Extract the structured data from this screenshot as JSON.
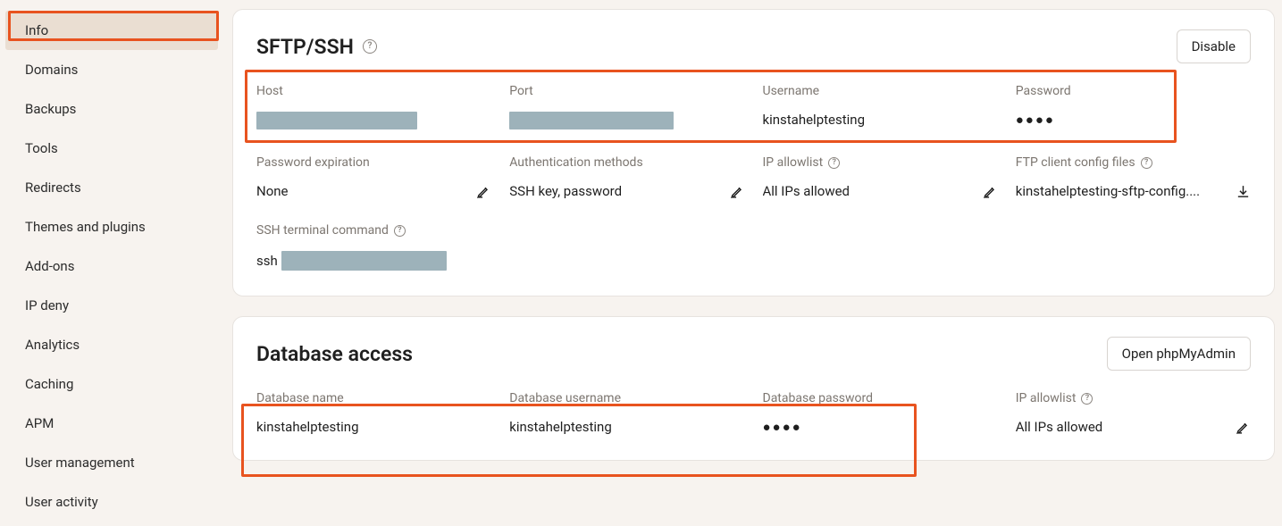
{
  "sidebar": {
    "items": [
      {
        "label": "Info"
      },
      {
        "label": "Domains"
      },
      {
        "label": "Backups"
      },
      {
        "label": "Tools"
      },
      {
        "label": "Redirects"
      },
      {
        "label": "Themes and plugins"
      },
      {
        "label": "Add-ons"
      },
      {
        "label": "IP deny"
      },
      {
        "label": "Analytics"
      },
      {
        "label": "Caching"
      },
      {
        "label": "APM"
      },
      {
        "label": "User management"
      },
      {
        "label": "User activity"
      }
    ]
  },
  "sftp": {
    "title": "SFTP/SSH",
    "disable_label": "Disable",
    "fields": {
      "host_label": "Host",
      "port_label": "Port",
      "username_label": "Username",
      "username_value": "kinstahelptesting",
      "password_label": "Password",
      "password_value": "●●●●",
      "pw_exp_label": "Password expiration",
      "pw_exp_value": "None",
      "auth_label": "Authentication methods",
      "auth_value": "SSH key, password",
      "allowlist_label": "IP allowlist",
      "allowlist_value": "All IPs allowed",
      "ftpfiles_label": "FTP client config files",
      "ftpfiles_value": "kinstahelptesting-sftp-config....",
      "sshcmd_label": "SSH terminal command",
      "sshcmd_prefix": "ssh"
    }
  },
  "db": {
    "title": "Database access",
    "open_label": "Open phpMyAdmin",
    "fields": {
      "name_label": "Database name",
      "name_value": "kinstahelptesting",
      "user_label": "Database username",
      "user_value": "kinstahelptesting",
      "pass_label": "Database password",
      "pass_value": "●●●●",
      "allowlist_label": "IP allowlist",
      "allowlist_value": "All IPs allowed"
    }
  }
}
